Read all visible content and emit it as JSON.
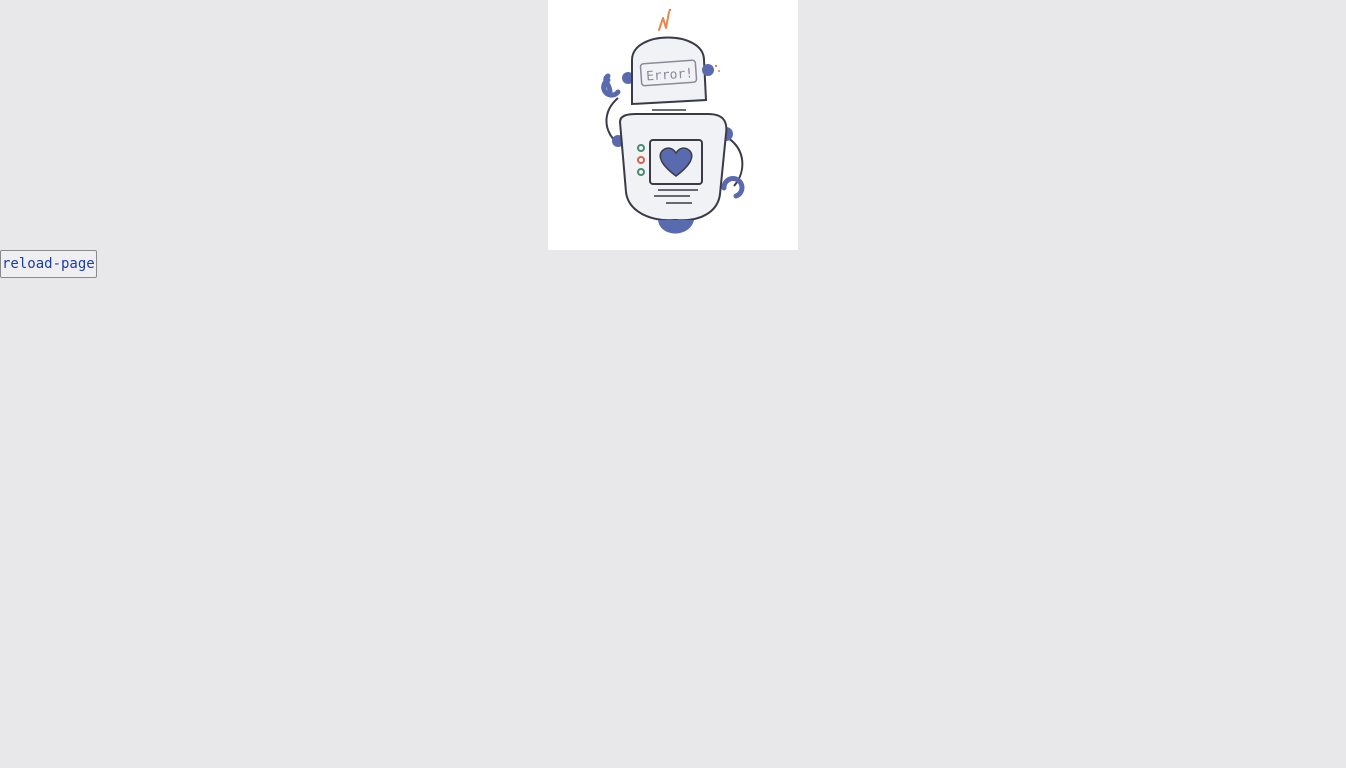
{
  "illustration": {
    "name": "error-robot",
    "screen_text": "Error!",
    "colors": {
      "outline": "#3b3b48",
      "body": "#f1f2f6",
      "accent": "#5a6aae",
      "spark": "#e8854a",
      "light_green": "#4a8a6a",
      "light_red": "#d2664a"
    }
  },
  "actions": {
    "reload_label": "reload-page"
  }
}
